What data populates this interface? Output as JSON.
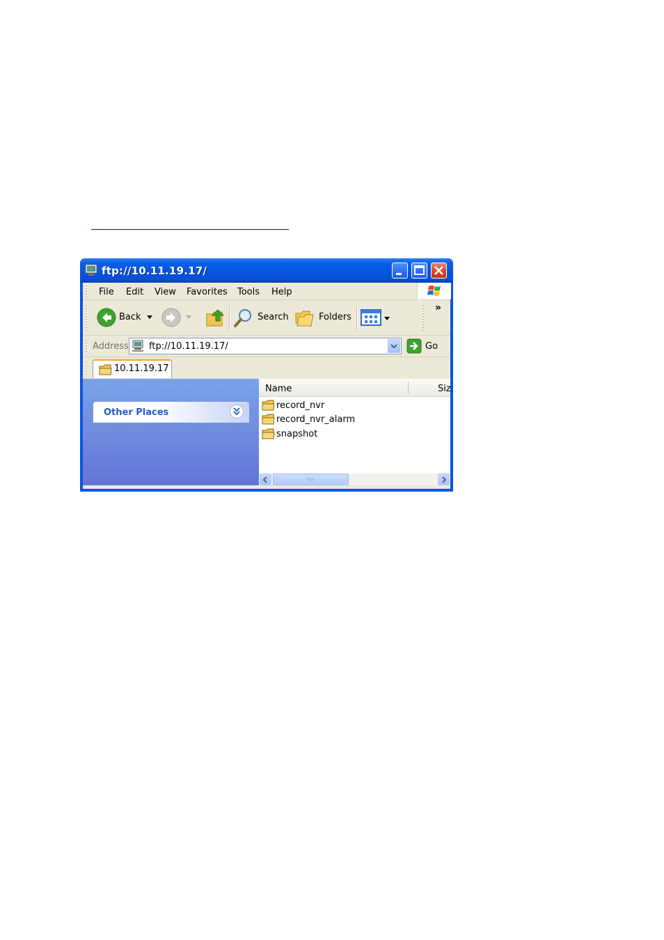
{
  "window": {
    "title": "ftp://10.11.19.17/"
  },
  "menu": {
    "items": [
      "File",
      "Edit",
      "View",
      "Favorites",
      "Tools",
      "Help"
    ]
  },
  "toolbar": {
    "back_label": "Back",
    "search_label": "Search",
    "folders_label": "Folders",
    "overflow_label": "»"
  },
  "address": {
    "label": "Address",
    "value": "ftp://10.11.19.17/",
    "go_label": "Go"
  },
  "tab": {
    "label": "10.11.19.17"
  },
  "sidebar": {
    "other_places_label": "Other Places"
  },
  "filelist": {
    "columns": [
      "Name",
      "Siz"
    ],
    "items": [
      "record_nvr",
      "record_nvr_alarm",
      "snapshot"
    ]
  },
  "icons": {
    "folder": "folder-icon",
    "back": "back-arrow-icon",
    "forward": "forward-arrow-icon",
    "up": "up-folder-icon",
    "search": "search-magnifier-icon",
    "views": "views-icon",
    "go": "go-arrow-icon"
  },
  "colors": {
    "titlebar": "#0553e0",
    "close_button": "#d6471f",
    "sidebar_top": "#7ba2e7",
    "sidebar_bottom": "#6375d6",
    "link_text": "#215dc6"
  }
}
